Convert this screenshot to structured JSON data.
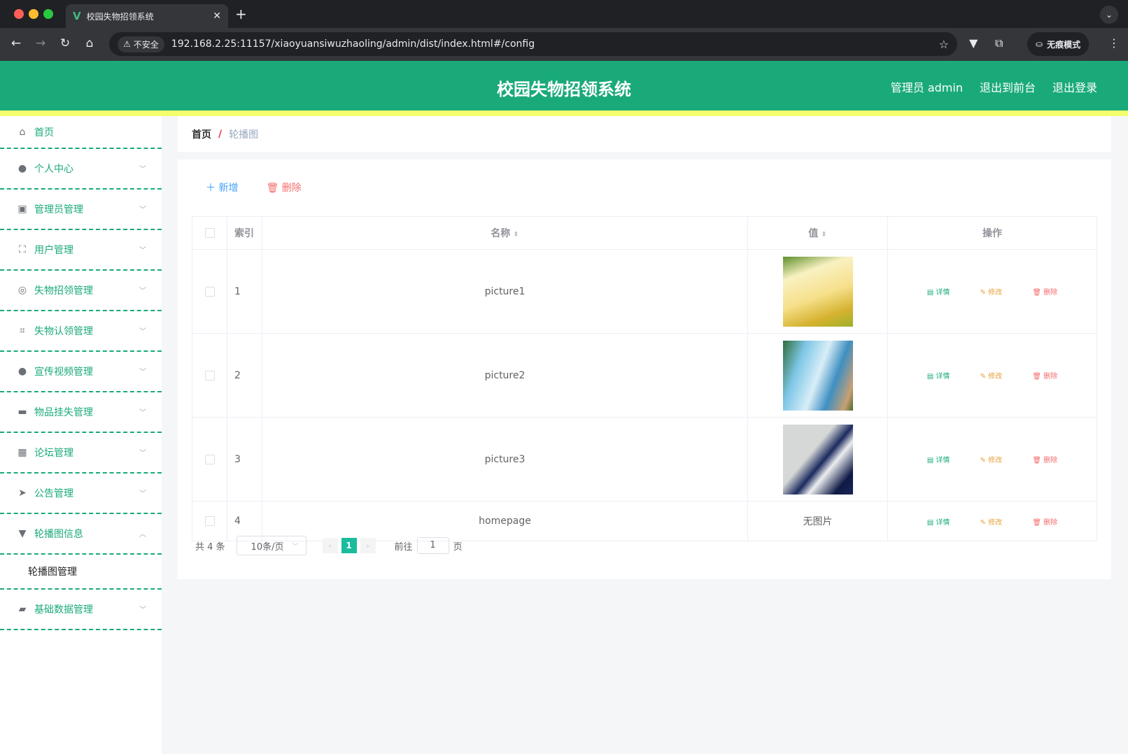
{
  "browser": {
    "tab_title": "校园失物招领系统",
    "tab_close": "✕",
    "new_tab": "+",
    "tab_menu": "⌄",
    "security_label": "不安全",
    "url": "192.168.2.25:11157/xiaoyuansiwuzhaoling/admin/dist/index.html#/config",
    "incognito_label": "无痕模式"
  },
  "header": {
    "title": "校园失物招领系统",
    "user": "管理员 admin",
    "to_front": "退出到前台",
    "logout": "退出登录"
  },
  "sidebar": {
    "items": [
      {
        "label": "首页",
        "icon": "home-icon"
      },
      {
        "label": "个人中心",
        "icon": "user-icon"
      },
      {
        "label": "管理员管理",
        "icon": "clipboard-icon"
      },
      {
        "label": "用户管理",
        "icon": "fullscreen-icon"
      },
      {
        "label": "失物招领管理",
        "icon": "compass-icon"
      },
      {
        "label": "失物认领管理",
        "icon": "crop-icon"
      },
      {
        "label": "宣传视频管理",
        "icon": "user-icon"
      },
      {
        "label": "物品挂失管理",
        "icon": "briefcase-icon"
      },
      {
        "label": "论坛管理",
        "icon": "grid-icon"
      },
      {
        "label": "公告管理",
        "icon": "send-icon"
      },
      {
        "label": "轮播图信息",
        "icon": "brush-icon"
      },
      {
        "label": "基础数据管理",
        "icon": "ticket-icon"
      }
    ],
    "subitem": "轮播图管理"
  },
  "breadcrumb": {
    "home": "首页",
    "separator": "/",
    "current": "轮播图"
  },
  "toolbar": {
    "add": "新增",
    "delete": "删除"
  },
  "table": {
    "headers": {
      "index": "索引",
      "name": "名称",
      "value": "值",
      "ops": "操作"
    },
    "rows": [
      {
        "index": "1",
        "name": "picture1",
        "value": ""
      },
      {
        "index": "2",
        "name": "picture2",
        "value": ""
      },
      {
        "index": "3",
        "name": "picture3",
        "value": ""
      },
      {
        "index": "4",
        "name": "homepage",
        "value": "无图片"
      }
    ],
    "op_labels": {
      "detail": "详情",
      "edit": "修改",
      "delete": "删除"
    }
  },
  "pagination": {
    "total": "共 4 条",
    "page_size": "10条/页",
    "current_page": "1",
    "goto_prefix": "前往",
    "goto_value": "1",
    "goto_suffix": "页"
  },
  "colors": {
    "primary": "#1aaa7a",
    "accent_bar": "#f5ff6e",
    "danger": "#f56c6c",
    "warning": "#e6a23c",
    "link": "#409eff"
  }
}
